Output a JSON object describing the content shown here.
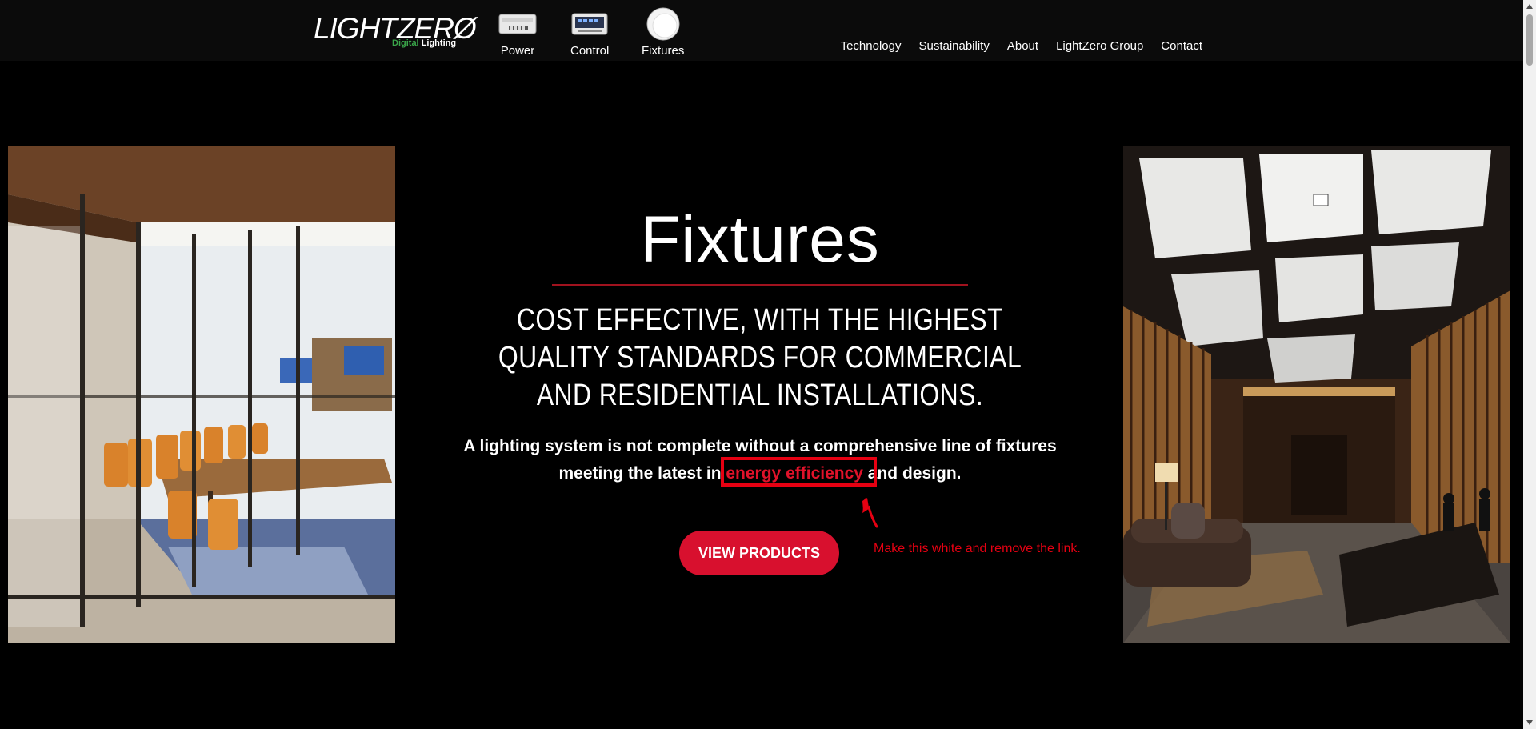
{
  "header": {
    "logo": {
      "wordmark": "LIGHTZERØ",
      "sub_green": "Digital",
      "sub_white": "Lighting"
    },
    "product_nav": [
      {
        "label": "Power",
        "icon": "power-supply-icon"
      },
      {
        "label": "Control",
        "icon": "control-panel-icon"
      },
      {
        "label": "Fixtures",
        "icon": "fixture-disc-icon"
      }
    ],
    "main_nav": [
      "Technology",
      "Sustainability",
      "About",
      "LightZero Group",
      "Contact"
    ]
  },
  "hero": {
    "title": "Fixtures",
    "subtitle": "COST EFFECTIVE, WITH THE HIGHEST QUALITY STANDARDS FOR COMMERCIAL AND RESIDENTIAL INSTALLATIONS.",
    "body_before": "A lighting system is not complete without a comprehensive line of fixtures meeting the latest in ",
    "body_link": "energy efficiency",
    "body_after": " and design.",
    "cta": "VIEW PRODUCTS"
  },
  "images": {
    "left": "conference-room-photo",
    "right": "hotel-lobby-photo"
  },
  "annotation": {
    "note": "Make this white and remove the link."
  },
  "colors": {
    "background": "#000000",
    "header": "#0b0b0b",
    "accent_red": "#d8102e",
    "rule_red": "#a0121e",
    "annotation_red": "#e60012",
    "logo_green": "#3aa64a"
  }
}
